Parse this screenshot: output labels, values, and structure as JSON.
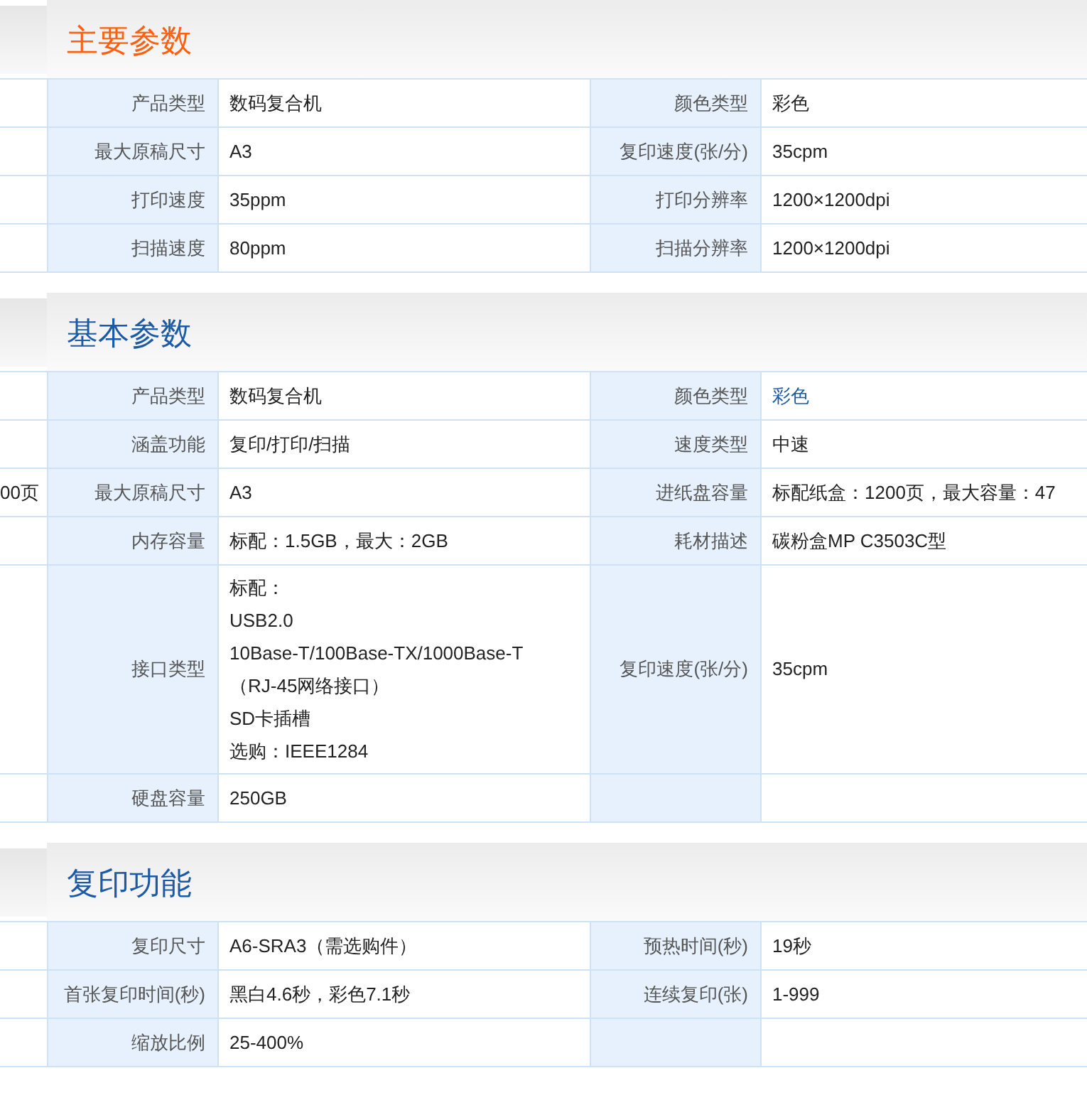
{
  "sections": [
    {
      "title": "主要参数",
      "highlighted": true,
      "rows": [
        {
          "cells": [
            {
              "label": "产品类型",
              "value": "数码复合机"
            },
            {
              "label": "颜色类型",
              "value": "彩色"
            }
          ]
        },
        {
          "cells": [
            {
              "label": "最大原稿尺寸",
              "value": "A3"
            },
            {
              "label": "复印速度(张/分)",
              "value": "35cpm"
            }
          ]
        },
        {
          "cells": [
            {
              "label": "打印速度",
              "value": "35ppm"
            },
            {
              "label": "打印分辨率",
              "value": "1200×1200dpi"
            }
          ]
        },
        {
          "cells": [
            {
              "label": "扫描速度",
              "value": "80ppm"
            },
            {
              "label": "扫描分辨率",
              "value": "1200×1200dpi"
            }
          ]
        }
      ]
    },
    {
      "title": "基本参数",
      "highlighted": false,
      "rows": [
        {
          "cells": [
            {
              "label": "产品类型",
              "value": "数码复合机"
            },
            {
              "label": "颜色类型",
              "value": "彩色",
              "link": true
            }
          ]
        },
        {
          "cells": [
            {
              "label": "涵盖功能",
              "value": "复印/打印/扫描"
            },
            {
              "label": "速度类型",
              "value": "中速"
            }
          ]
        },
        {
          "strip_text": "00页",
          "cells": [
            {
              "label": "最大原稿尺寸",
              "value": "A3"
            },
            {
              "label": "进纸盘容量",
              "value": "标配纸盒：1200页，最大容量：47"
            }
          ]
        },
        {
          "cells": [
            {
              "label": "内存容量",
              "value": "标配：1.5GB，最大：2GB"
            },
            {
              "label": "耗材描述",
              "value": "碳粉盒MP C3503C型"
            }
          ]
        },
        {
          "cells": [
            {
              "label": "接口类型",
              "lines": [
                "标配：",
                "USB2.0",
                "10Base-T/100Base-TX/1000Base-T",
                "（RJ-45网络接口）",
                "SD卡插槽",
                "选购：IEEE1284"
              ]
            },
            {
              "label": "复印速度(张/分)",
              "value": "35cpm"
            }
          ]
        },
        {
          "cells": [
            {
              "label": "硬盘容量",
              "value": "250GB"
            }
          ]
        }
      ]
    },
    {
      "title": "复印功能",
      "highlighted": false,
      "rows": [
        {
          "cells": [
            {
              "label": "复印尺寸",
              "value": "A6-SRA3（需选购件）"
            },
            {
              "label": "预热时间(秒)",
              "value": "19秒"
            }
          ]
        },
        {
          "cells": [
            {
              "label": "首张复印时间(秒)",
              "value": "黑白4.6秒，彩色7.1秒"
            },
            {
              "label": "连续复印(张)",
              "value": "1-999"
            }
          ]
        },
        {
          "cells": [
            {
              "label": "缩放比例",
              "value": "25-400%"
            }
          ]
        }
      ]
    }
  ]
}
